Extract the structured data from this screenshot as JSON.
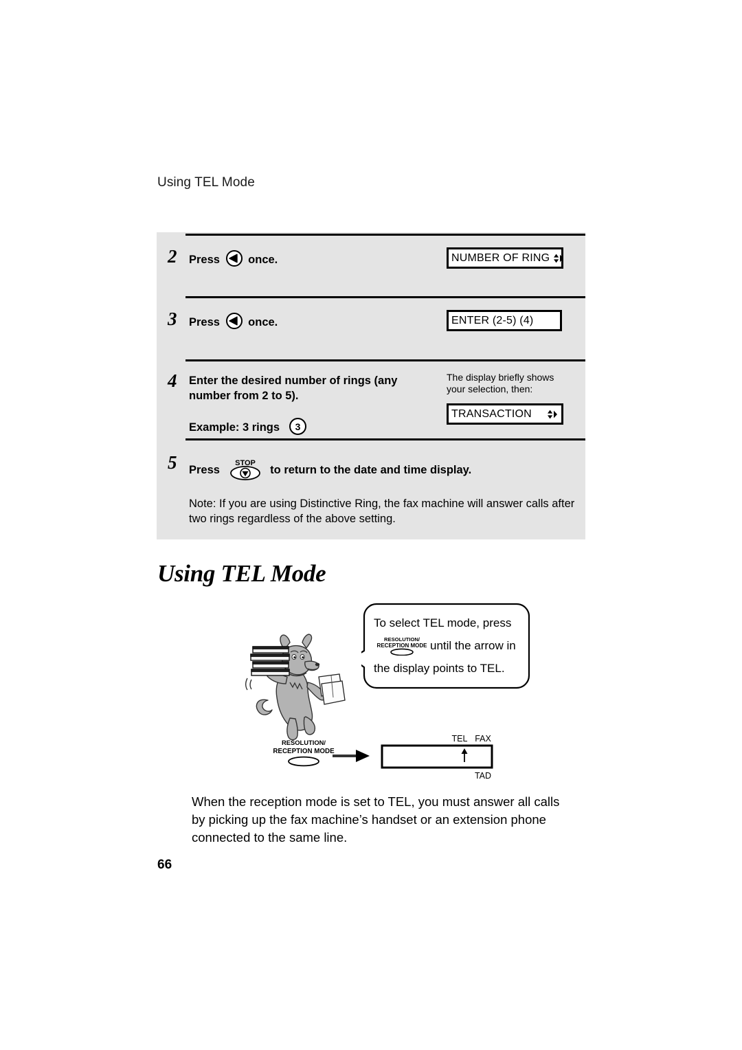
{
  "page": {
    "running_header": "Using TEL Mode",
    "page_number": "66"
  },
  "procedure": {
    "steps": [
      {
        "number": "2",
        "text_before_key": "Press",
        "key_icon": "round-right-arrow-key",
        "text_after_key": "once.",
        "lcd": {
          "text": "NUMBER OF RING",
          "arrows": "up-down-right-arrows"
        }
      },
      {
        "number": "3",
        "text_before_key": "Press",
        "key_icon": "round-right-arrow-key",
        "text_after_key": "once.",
        "lcd": {
          "text": "ENTER (2-5) (4)",
          "arrows": ""
        }
      },
      {
        "number": "4",
        "line1": "Enter the desired number of rings (any",
        "line2": "number from 2 to 5).",
        "example_label": "Example: 3 rings",
        "example_value": "3",
        "lcd_caption_line1": "The display briefly shows",
        "lcd_caption_line2": "your selection, then:",
        "lcd": {
          "text": "TRANSACTION",
          "arrows": "up-down-right-arrows"
        }
      },
      {
        "number": "5",
        "text_before_key": "Press",
        "key_icon": "stop-key",
        "key_label": "STOP",
        "text_after_key": "to return to the date and time display."
      }
    ],
    "note": "Note: If you are using Distinctive Ring, the fax machine will answer calls after two rings regardless of the above setting."
  },
  "section": {
    "heading": "Using TEL Mode",
    "bubble": {
      "line1": "To select TEL mode, press",
      "button_label_line1": "RESOLUTION/",
      "button_label_line2": "RECEPTION MODE",
      "line2_after_button": "until the arrow in",
      "line3": "the display points to TEL."
    },
    "panel_diagram": {
      "button_label_line1": "RESOLUTION/",
      "button_label_line2": "RECEPTION MODE",
      "display_top_left": "TEL",
      "display_top_right": "FAX",
      "display_bottom_right": "TAD",
      "arrow_indicator": "up-arrow"
    },
    "body_text": "When the reception mode is set to TEL, you must answer all calls by picking up the fax machine’s handset or an extension phone connected to the same line."
  },
  "colors": {
    "panel_background": "#e4e4e4",
    "rule": "#000000",
    "mascot_fill": "#b3b3b3",
    "page_background": "#ffffff"
  }
}
